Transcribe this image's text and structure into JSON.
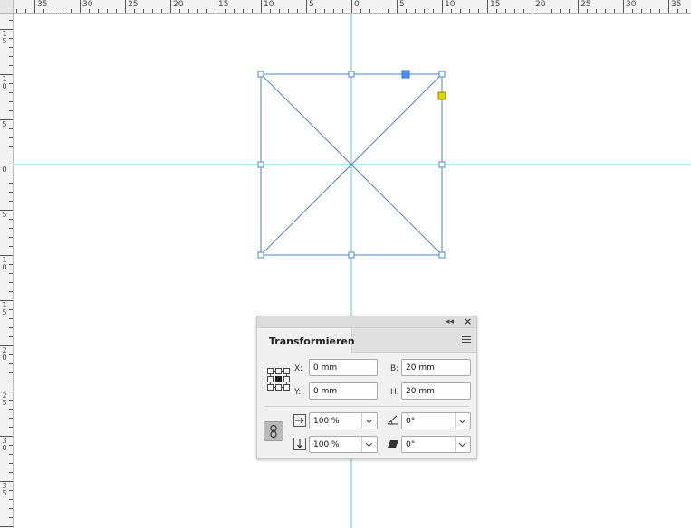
{
  "ruler": {
    "top_labels": [
      "35",
      "30",
      "25",
      "20",
      "15",
      "10",
      "5",
      "0",
      "5",
      "10",
      "15",
      "20",
      "25",
      "30",
      "35"
    ],
    "left_labels": [
      "15",
      "10",
      "5",
      "0",
      "5",
      "10",
      "15",
      "20",
      "25",
      "30",
      "35"
    ]
  },
  "colors": {
    "guide": "#4fd6d3",
    "selection": "#4a86c9",
    "handle_active": "#4a90ff",
    "handle_corner": "#d8d800"
  },
  "panel": {
    "collapse_icon": "double-chevron-left-icon",
    "close_icon": "close-icon",
    "tab_label": "Transformieren",
    "menu_icon": "hamburger-menu-icon",
    "x_label": "X:",
    "x_value": "0 mm",
    "y_label": "Y:",
    "y_value": "0 mm",
    "w_label": "B:",
    "w_value": "20 mm",
    "h_label": "H:",
    "h_value": "20 mm",
    "scale_x_value": "100 %",
    "scale_y_value": "100 %",
    "rotation_value": "0°",
    "shear_value": "0°"
  }
}
